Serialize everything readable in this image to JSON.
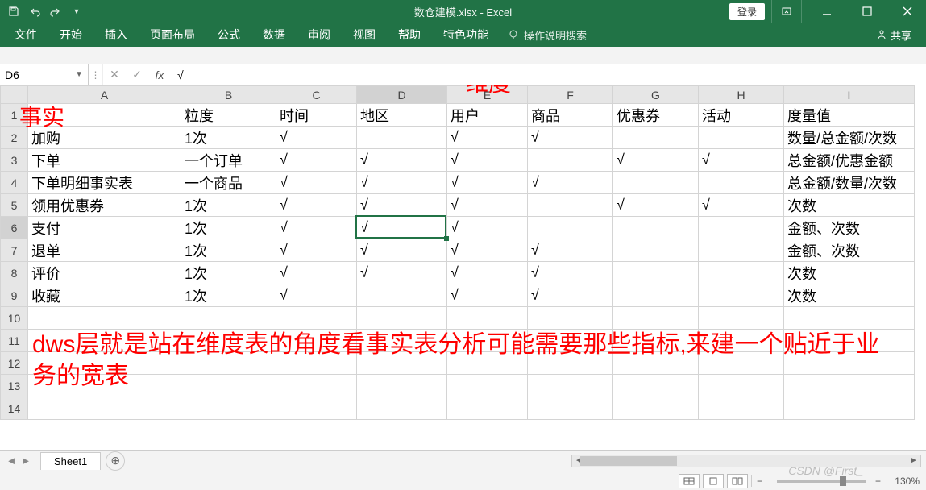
{
  "title_bar": {
    "doc_title": "数仓建模.xlsx - Excel",
    "login_label": "登录"
  },
  "ribbon_tabs": [
    "文件",
    "开始",
    "插入",
    "页面布局",
    "公式",
    "数据",
    "审阅",
    "视图",
    "帮助",
    "特色功能"
  ],
  "tell_me": "操作说明搜索",
  "share_label": "共享",
  "formula_bar": {
    "cell_ref": "D6",
    "formula": "√"
  },
  "columns": [
    "A",
    "B",
    "C",
    "D",
    "E",
    "F",
    "G",
    "H",
    "I"
  ],
  "active": {
    "col": "D",
    "row": 6
  },
  "headers_row": [
    "",
    "粒度",
    "时间",
    "地区",
    "用户",
    "商品",
    "优惠券",
    "活动",
    "度量值"
  ],
  "rows": [
    [
      "加购",
      "1次",
      "√",
      "",
      "√",
      "√",
      "",
      "",
      "数量/总金额/次数"
    ],
    [
      "下单",
      "一个订单",
      "√",
      "√",
      "√",
      "",
      "√",
      "√",
      "总金额/优惠金额"
    ],
    [
      "下单明细事实表",
      "一个商品",
      "√",
      "√",
      "√",
      "√",
      "",
      "",
      "总金额/数量/次数"
    ],
    [
      "领用优惠券",
      "1次",
      "√",
      "√",
      "√",
      "",
      "√",
      "√",
      "次数"
    ],
    [
      "支付",
      "1次",
      "√",
      "√",
      "√",
      "",
      "",
      "",
      "金额、次数"
    ],
    [
      "退单",
      "1次",
      "√",
      "√",
      "√",
      "√",
      "",
      "",
      "金额、次数"
    ],
    [
      "评价",
      "1次",
      "√",
      "√",
      "√",
      "√",
      "",
      "",
      "次数"
    ],
    [
      "收藏",
      "1次",
      "√",
      "",
      "√",
      "√",
      "",
      "",
      "次数"
    ]
  ],
  "blank_rows": [
    10,
    11,
    12,
    13,
    14
  ],
  "annotations": {
    "fact": "事实",
    "dimension": "维度",
    "note": "dws层就是站在维度表的角度看事实表分析可能需要那些指标,来建一个贴近于业务的宽表"
  },
  "sheet_tab": "Sheet1",
  "zoom": "130%",
  "watermark": "CSDN @First_"
}
